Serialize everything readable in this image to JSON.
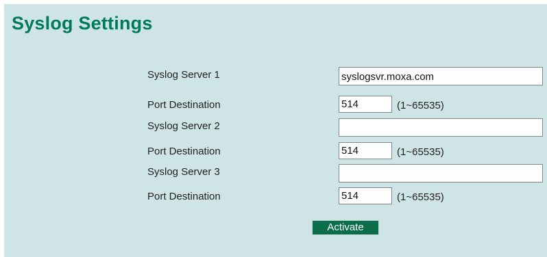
{
  "page": {
    "title": "Syslog Settings"
  },
  "rows": [
    {
      "label": "Syslog Server 1",
      "type": "server",
      "value": "syslogsvr.moxa.com"
    },
    {
      "label": "Port Destination",
      "type": "port",
      "value": "514",
      "hint": "(1~65535)"
    },
    {
      "label": "Syslog Server 2",
      "type": "server",
      "value": ""
    },
    {
      "label": "Port Destination",
      "type": "port",
      "value": "514",
      "hint": "(1~65535)"
    },
    {
      "label": "Syslog Server 3",
      "type": "server",
      "value": ""
    },
    {
      "label": "Port Destination",
      "type": "port",
      "value": "514",
      "hint": "(1~65535)"
    }
  ],
  "actions": {
    "activate_label": "Activate"
  },
  "colors": {
    "panel_background": "#cfe5e5",
    "title": "#007a5e",
    "button_background": "#0a6e4a",
    "button_text": "#ffffff"
  }
}
